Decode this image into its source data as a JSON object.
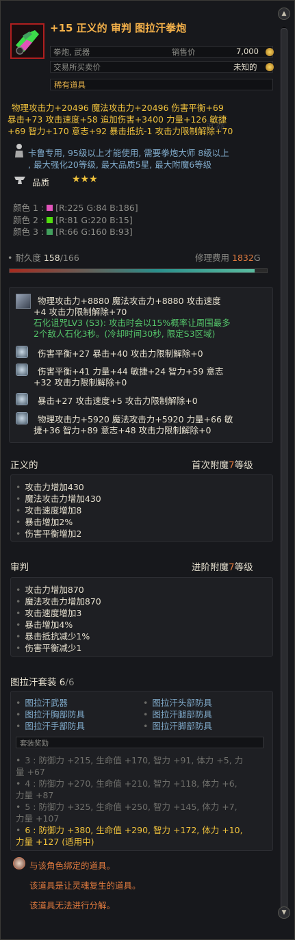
{
  "item": {
    "title": "+15 正义的 审判 图拉汗拳炮",
    "type": "拳炮, 武器",
    "sell_label": "销售价",
    "sell_value": "7,000",
    "trade_label": "交易所买卖价",
    "trade_value": "未知的",
    "rarity": "稀有道具"
  },
  "base_stats": {
    "line1": "物理攻击力+20496  魔法攻击力+20496  伤害平衡+69",
    "line2": "暴击+73  攻击速度+58  追加伤害+3400  力量+126  敏捷",
    "line3": "+69  智力+170  意志+92  暴击抵抗-1  攻击力限制解除+70",
    "faded_overlay": "武器"
  },
  "requirement": {
    "line1": "卡鲁专用, 95级以上才能使用, 需要拳炮大师 8级以上",
    "line2": ", 最大强化20等级, 最大品质5星, 最大附魔6等级"
  },
  "quality": {
    "label": "品质",
    "stars": "★★★"
  },
  "colors": [
    {
      "label": "颜色 1 :",
      "value": "[R:225 G:84 B:186]",
      "hex": "#e154ba"
    },
    {
      "label": "颜色 2 :",
      "value": "[R:81 G:220 B:15]",
      "hex": "#51dc0f"
    },
    {
      "label": "颜色 3 :",
      "value": "[R:66 G:160 B:93]",
      "hex": "#42a05d"
    }
  ],
  "durability": {
    "label": "耐久度",
    "current": "158",
    "max": "/166",
    "progress": 0.952,
    "repair_label": "修理费用",
    "repair_value": "1832",
    "repair_unit": "G"
  },
  "reforge": [
    {
      "lines": [
        "物理攻击力+8880  魔法攻击力+8880  攻击速度",
        "+4  攻击力限制解除+70"
      ],
      "extra": [
        "石化诅咒LV3 (S3): 攻击时会以15%概率让周围最多",
        "2个敌人石化3秒。(冷却时间30秒, 限定S3区域)"
      ]
    },
    {
      "lines": [
        "伤害平衡+27  暴击+40  攻击力限制解除+0"
      ]
    },
    {
      "lines": [
        "伤害平衡+41  力量+44  敏捷+24  智力+59  意志",
        "+32  攻击力限制解除+0"
      ]
    },
    {
      "lines": [
        "暴击+27  攻击速度+5  攻击力限制解除+0"
      ]
    },
    {
      "lines": [
        "物理攻击力+5920  魔法攻击力+5920  力量+66  敏",
        "捷+36  智力+89  意志+48  攻击力限制解除+0"
      ]
    }
  ],
  "enchant1": {
    "name": "正义的",
    "level_prefix": "首次附魔",
    "level": "7",
    "level_suffix": "等级",
    "effects": [
      "攻击力增加430",
      "魔法攻击力增加430",
      "攻击速度增加8",
      "暴击增加2%",
      "伤害平衡增加2"
    ]
  },
  "enchant2": {
    "name": "审判",
    "level_prefix": "进阶附魔",
    "level": "7",
    "level_suffix": "等级",
    "effects": [
      "攻击力增加870",
      "魔法攻击力增加870",
      "攻击速度增加3",
      "暴击增加4%",
      "暴击抵抗减少1%",
      "伤害平衡减少1"
    ]
  },
  "set": {
    "name": "图拉汗套装",
    "count": "6",
    "total": "/6",
    "pieces": [
      "图拉汗武器",
      "图拉汗头部防具",
      "图拉汗胸部防具",
      "图拉汗腿部防具",
      "图拉汗手部防具",
      "图拉汗脚部防具"
    ],
    "bonus_header": "套装奖励",
    "bonuses": [
      {
        "lines": [
          "3 : 防御力 +215, 生命值 +170, 智力 +91, 体力 +5, 力",
          "量 +67"
        ],
        "active": false
      },
      {
        "lines": [
          "4 : 防御力 +270, 生命值 +210, 智力 +118, 体力 +6,",
          "力量 +87"
        ],
        "active": false
      },
      {
        "lines": [
          "5 : 防御力 +325, 生命值 +250, 智力 +145, 体力 +7,",
          "力量 +107"
        ],
        "active": false
      },
      {
        "lines": [
          "6 : 防御力 +380, 生命值 +290, 智力 +172, 体力 +10,",
          "力量 +127 (适用中)"
        ],
        "active": true
      }
    ]
  },
  "notes": [
    "与该角色绑定的道具。",
    "该道具是让灵魂复生的道具。",
    "该道具无法进行分解。"
  ]
}
